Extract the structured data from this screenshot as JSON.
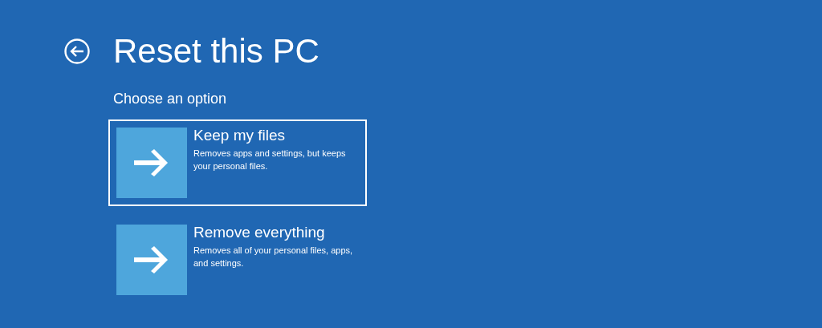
{
  "header": {
    "title": "Reset this PC",
    "subtitle": "Choose an option"
  },
  "options": [
    {
      "title": "Keep my files",
      "description": "Removes apps and settings, but keeps your personal files.",
      "selected": true
    },
    {
      "title": "Remove everything",
      "description": "Removes all of your personal files, apps, and settings.",
      "selected": false
    }
  ]
}
